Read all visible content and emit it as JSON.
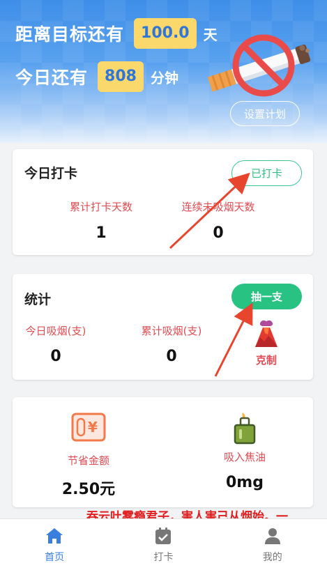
{
  "header": {
    "goal_prefix": "距离目标还有",
    "goal_value": "100.0",
    "goal_unit": "天",
    "today_prefix": "今日还有",
    "today_value": "808",
    "today_unit": "分钟",
    "plan_button": "设置计划",
    "illustration": "no-smoking-icon"
  },
  "checkin_card": {
    "title": "今日打卡",
    "status_button": "已打卡",
    "stats": [
      {
        "label": "累计打卡天数",
        "value": "1"
      },
      {
        "label": "连续未吸烟天数",
        "value": "0"
      }
    ]
  },
  "stats_card": {
    "title": "统计",
    "smoke_button": "抽一支",
    "stats": [
      {
        "label": "今日吸烟(支)",
        "value": "0"
      },
      {
        "label": "累计吸烟(支)",
        "value": "0"
      }
    ],
    "resist_label": "克制",
    "resist_icon": "volcano-icon"
  },
  "savings_card": {
    "items": [
      {
        "label": "节省金额",
        "value": "2.50元",
        "icon": "money-icon"
      },
      {
        "label": "吸入焦油",
        "value": "0mg",
        "icon": "lighter-icon"
      }
    ]
  },
  "marquee_text": "吞云吐雾瘾君子，害人害己从烟始。一",
  "tabbar": {
    "items": [
      {
        "label": "首页",
        "icon": "home-icon",
        "active": true
      },
      {
        "label": "打卡",
        "icon": "calendar-check-icon",
        "active": false
      },
      {
        "label": "我的",
        "icon": "user-icon",
        "active": false
      }
    ]
  },
  "colors": {
    "accent_green": "#28c283",
    "label_red": "#e14b52",
    "badge_yellow": "#fbd86b",
    "tab_active": "#3a7fe0"
  }
}
